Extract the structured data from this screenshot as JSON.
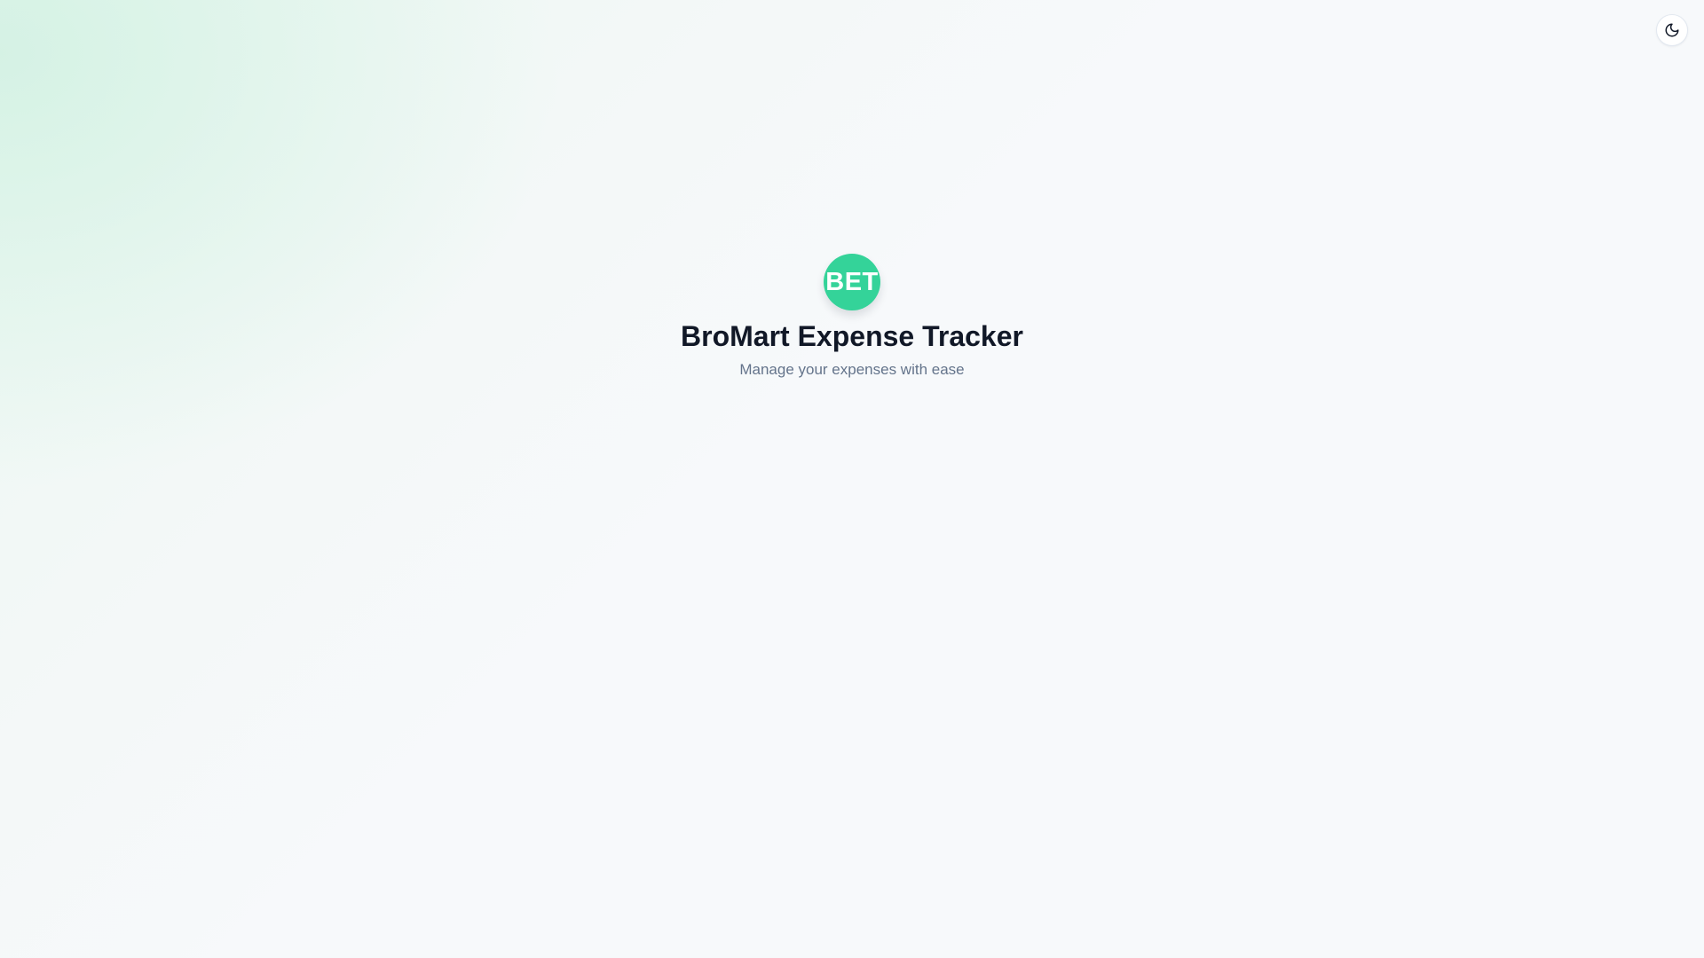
{
  "app": {
    "logo_text": "BET",
    "title": "BroMart Expense Tracker",
    "subtitle": "Manage your expenses with ease"
  },
  "header": {
    "theme_toggle": {
      "icon": "moon-icon"
    }
  },
  "colors": {
    "brand": "#34d399",
    "title": "#111827",
    "subtitle": "#64748b",
    "background": "#f7f9fb",
    "background_tint": "#e9f7f0"
  }
}
